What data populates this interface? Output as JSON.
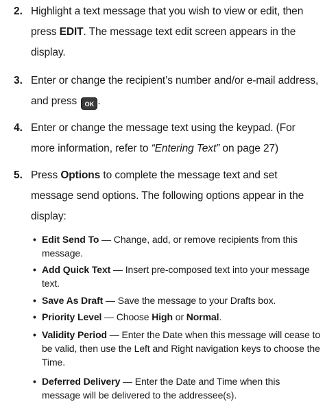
{
  "steps": [
    {
      "num": "2.",
      "pre": "Highlight a text message that you wish to view or edit, then press ",
      "bold": "EDIT",
      "post": ". The message text edit screen appears in the display."
    },
    {
      "num": "3.",
      "pre": "Enter or change the recipient’s number and/or e-mail address, and press ",
      "icon_label": "OK",
      "icon_name": "ok-key-icon",
      "post": "."
    },
    {
      "num": "4.",
      "pre": "Enter or change the message text using the keypad. (For more information, refer to ",
      "italic": "“Entering Text”",
      "post": " on page 27)"
    },
    {
      "num": "5.",
      "pre": "Press ",
      "bold": "Options",
      "post": " to complete the message text and set message send options. The following options appear in the display:"
    }
  ],
  "options": [
    {
      "term": "Edit Send To",
      "desc": " — Change, add, or remove recipients from this message."
    },
    {
      "term": "Add Quick Text",
      "desc": " — Insert pre-composed text into your message text."
    },
    {
      "term": "Save As Draft",
      "desc": " — Save the message to your Drafts box."
    },
    {
      "term": "Priority Level",
      "desc_pre": " — Choose ",
      "bold1": "High",
      "mid": " or ",
      "bold2": "Normal",
      "desc_post": "."
    },
    {
      "term": "Validity Period",
      "desc": " — Enter the Date when this message will cease to be valid, then use the Left and Right navigation keys to choose the Time."
    },
    {
      "term": "Deferred Delivery",
      "desc": " — Enter the Date and Time when this message will be delivered to the addressee(s)."
    }
  ],
  "bullet_char": "•"
}
